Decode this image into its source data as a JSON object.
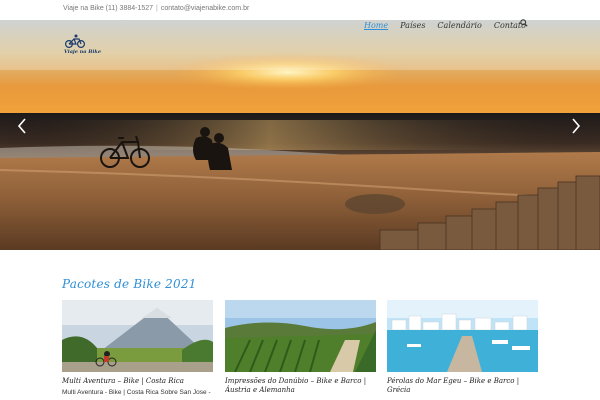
{
  "topbar": {
    "phone": "Viaje na Bike (11) 3884-1527",
    "separator": "|",
    "email": "contato@viajenabike.com.br"
  },
  "logo": {
    "text": "Viaje na Bike",
    "icon": "cyclist-icon"
  },
  "nav": {
    "items": [
      {
        "label": "Home",
        "active": true
      },
      {
        "label": "Países",
        "active": false
      },
      {
        "label": "Calendário",
        "active": false
      },
      {
        "label": "Contato",
        "active": false
      }
    ],
    "search_icon": "search-icon"
  },
  "hero": {
    "prev_icon": "chevron-left-icon",
    "next_icon": "chevron-right-icon"
  },
  "section": {
    "title": "Pacotes de Bike 2021"
  },
  "cards": [
    {
      "title": "Multi Aventura – Bike | Costa Rica",
      "desc": "Multi Aventura - Bike | Costa Rica Sobre San Jose -"
    },
    {
      "title": "Impressões do Danúbio – Bike e Barco | Áustria e Alemanha",
      "desc": ""
    },
    {
      "title": "Pérolas do Mar Egeu – Bike e Barco | Grécia",
      "desc": ""
    }
  ],
  "colors": {
    "accent": "#2e8fd6",
    "text": "#333333"
  }
}
